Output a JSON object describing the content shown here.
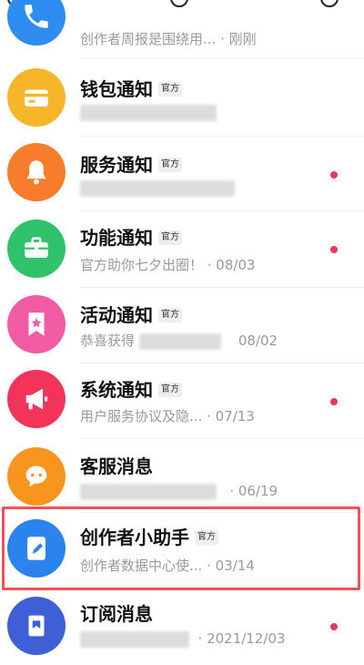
{
  "items": [
    {
      "title": "",
      "badge": "",
      "subtitle": "创作者周报是围绕用... · 刚刚",
      "color": "#2f8df2",
      "icon": "phone-icon",
      "dot": false
    },
    {
      "title": "钱包通知",
      "badge": "官方",
      "subtitle": "",
      "color": "#f7b52a",
      "icon": "wallet-icon",
      "dot": false
    },
    {
      "title": "服务通知",
      "badge": "官方",
      "subtitle": "",
      "color": "#f77d2c",
      "icon": "bell-icon",
      "dot": true
    },
    {
      "title": "功能通知",
      "badge": "官方",
      "subtitle": "官方助你七夕出圈！ · 08/03",
      "color": "#2fc26a",
      "icon": "briefcase-icon",
      "dot": true
    },
    {
      "title": "活动通知",
      "badge": "官方",
      "subtitle": "恭喜获得",
      "subtitle_tail": "08/02",
      "color": "#f05ba4",
      "icon": "star-bookmark-icon",
      "dot": false
    },
    {
      "title": "系统通知",
      "badge": "官方",
      "subtitle": "用户服务协议及隐... · 07/13",
      "color": "#f2335a",
      "icon": "megaphone-icon",
      "dot": true
    },
    {
      "title": "客服消息",
      "badge": "",
      "subtitle": "· 06/19",
      "color": "#f7951e",
      "icon": "chat-icon",
      "dot": false
    },
    {
      "title": "创作者小助手",
      "badge": "官方",
      "subtitle": "创作者数据中心使... · 03/14",
      "color": "#2b83ee",
      "icon": "edit-icon",
      "dot": false
    },
    {
      "title": "订阅消息",
      "badge": "",
      "subtitle": "· 2021/12/03",
      "color": "#3e5fd6",
      "icon": "subscription-icon",
      "dot": true
    }
  ]
}
